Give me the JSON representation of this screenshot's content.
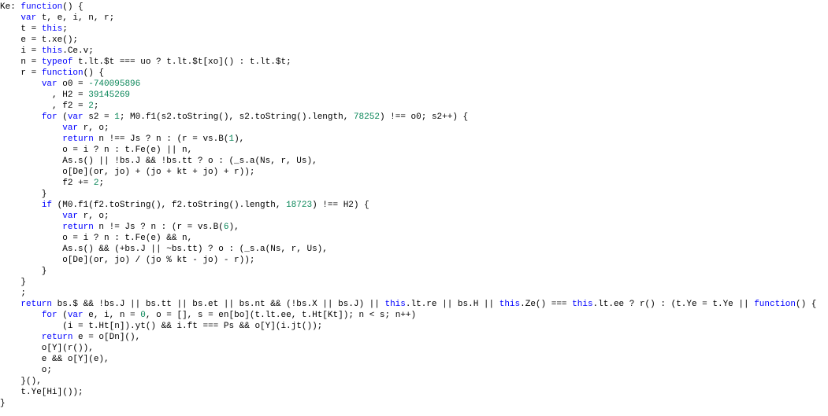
{
  "chart_data": null,
  "code": {
    "lines": [
      [
        [
          "id",
          "Ke: "
        ],
        [
          "kw",
          "function"
        ],
        [
          "op",
          "() {"
        ]
      ],
      [
        [
          "op",
          "    "
        ],
        [
          "kw",
          "var"
        ],
        [
          "op",
          " t, e, i, n, r;"
        ]
      ],
      [
        [
          "op",
          "    t = "
        ],
        [
          "kw",
          "this"
        ],
        [
          "op",
          ";"
        ]
      ],
      [
        [
          "op",
          "    e = t.xe();"
        ]
      ],
      [
        [
          "op",
          "    i = "
        ],
        [
          "kw",
          "this"
        ],
        [
          "op",
          ".Ce.v;"
        ]
      ],
      [
        [
          "op",
          "    n = "
        ],
        [
          "kw",
          "typeof"
        ],
        [
          "op",
          " t.lt.$t === uo ? t.lt.$t[xo]() : t.lt.$t;"
        ]
      ],
      [
        [
          "op",
          "    r = "
        ],
        [
          "kw",
          "function"
        ],
        [
          "op",
          "() {"
        ]
      ],
      [
        [
          "op",
          "        "
        ],
        [
          "kw",
          "var"
        ],
        [
          "op",
          " o0 = "
        ],
        [
          "num",
          "-740095896"
        ]
      ],
      [
        [
          "op",
          "          , H2 = "
        ],
        [
          "num",
          "39145269"
        ]
      ],
      [
        [
          "op",
          "          , f2 = "
        ],
        [
          "num",
          "2"
        ],
        [
          "op",
          ";"
        ]
      ],
      [
        [
          "op",
          "        "
        ],
        [
          "kw",
          "for"
        ],
        [
          "op",
          " ("
        ],
        [
          "kw",
          "var"
        ],
        [
          "op",
          " s2 = "
        ],
        [
          "num",
          "1"
        ],
        [
          "op",
          "; M0.f1(s2.toString(), s2.toString().length, "
        ],
        [
          "num",
          "78252"
        ],
        [
          "op",
          ") !== o0; s2++) {"
        ]
      ],
      [
        [
          "op",
          "            "
        ],
        [
          "kw",
          "var"
        ],
        [
          "op",
          " r, o;"
        ]
      ],
      [
        [
          "op",
          "            "
        ],
        [
          "kw",
          "return"
        ],
        [
          "op",
          " n !== Js ? n : (r = vs.B("
        ],
        [
          "num",
          "1"
        ],
        [
          "op",
          "),"
        ]
      ],
      [
        [
          "op",
          "            o = i ? n : t.Fe(e) || n,"
        ]
      ],
      [
        [
          "op",
          "            As.s() || !bs.J && !bs.tt ? o : (_s.a(Ns, r, Us),"
        ]
      ],
      [
        [
          "op",
          "            o[De](or, jo) + (jo + kt + jo) + r));"
        ]
      ],
      [
        [
          "op",
          "            f2 += "
        ],
        [
          "num",
          "2"
        ],
        [
          "op",
          ";"
        ]
      ],
      [
        [
          "op",
          "        }"
        ]
      ],
      [
        [
          "op",
          "        "
        ],
        [
          "kw",
          "if"
        ],
        [
          "op",
          " (M0.f1(f2.toString(), f2.toString().length, "
        ],
        [
          "num",
          "18723"
        ],
        [
          "op",
          ") !== H2) {"
        ]
      ],
      [
        [
          "op",
          "            "
        ],
        [
          "kw",
          "var"
        ],
        [
          "op",
          " r, o;"
        ]
      ],
      [
        [
          "op",
          "            "
        ],
        [
          "kw",
          "return"
        ],
        [
          "op",
          " n != Js ? n : (r = vs.B("
        ],
        [
          "num",
          "6"
        ],
        [
          "op",
          "),"
        ]
      ],
      [
        [
          "op",
          "            o = i ? n : t.Fe(e) && n,"
        ]
      ],
      [
        [
          "op",
          "            As.s() && (+bs.J || ~bs.tt) ? o : (_s.a(Ns, r, Us),"
        ]
      ],
      [
        [
          "op",
          "            o[De](or, jo) / (jo % kt - jo) - r));"
        ]
      ],
      [
        [
          "op",
          "        }"
        ]
      ],
      [
        [
          "op",
          "    }"
        ]
      ],
      [
        [
          "op",
          "    ;"
        ]
      ],
      [
        [
          "op",
          "    "
        ],
        [
          "kw",
          "return"
        ],
        [
          "op",
          " bs.$ && !bs.J || bs.tt || bs.et || bs.nt && (!bs.X || bs.J) || "
        ],
        [
          "kw",
          "this"
        ],
        [
          "op",
          ".lt.re || bs.H || "
        ],
        [
          "kw",
          "this"
        ],
        [
          "op",
          ".Ze() === "
        ],
        [
          "kw",
          "this"
        ],
        [
          "op",
          ".lt.ee ? r() : (t.Ye = t.Ye || "
        ],
        [
          "kw",
          "function"
        ],
        [
          "op",
          "() {"
        ]
      ],
      [
        [
          "op",
          "        "
        ],
        [
          "kw",
          "for"
        ],
        [
          "op",
          " ("
        ],
        [
          "kw",
          "var"
        ],
        [
          "op",
          " e, i, n = "
        ],
        [
          "num",
          "0"
        ],
        [
          "op",
          ", o = [], s = en[bo](t.lt.ee, t.Ht[Kt]); n < s; n++)"
        ]
      ],
      [
        [
          "op",
          "            (i = t.Ht[n]).yt() && i.ft === Ps && o[Y](i.jt());"
        ]
      ],
      [
        [
          "op",
          "        "
        ],
        [
          "kw",
          "return"
        ],
        [
          "op",
          " e = o[Dn](),"
        ]
      ],
      [
        [
          "op",
          "        o[Y](r()),"
        ]
      ],
      [
        [
          "op",
          "        e && o[Y](e),"
        ]
      ],
      [
        [
          "op",
          "        o;"
        ]
      ],
      [
        [
          "op",
          "    }(),"
        ]
      ],
      [
        [
          "op",
          "    t.Ye[Hi]());"
        ]
      ],
      [
        [
          "op",
          "}"
        ]
      ]
    ]
  }
}
